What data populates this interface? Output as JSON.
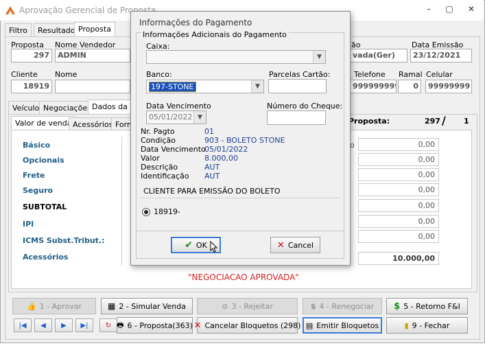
{
  "window": {
    "title": "Aprovação Gerencial de Proposta",
    "controls": [
      "–",
      "▢",
      "✕"
    ]
  },
  "main_tabs": [
    "Filtro",
    "Resultado",
    "Proposta"
  ],
  "header": {
    "proposta_label": "Proposta",
    "proposta_value": "297",
    "vendedor_label": "Nome Vendedor",
    "vendedor_value": "ADMIN",
    "situacao_label": "ão",
    "situacao_value": "vada(Ger)",
    "data_emissao_label": "Data Emissão",
    "data_emissao_value": "23/12/2021",
    "cliente_label": "Cliente",
    "cliente_value": "18919",
    "nome_label": "Nome",
    "telefone_label": "Telefone",
    "telefone_value": "999999999",
    "ramal_label": "Ramal",
    "ramal_value": "0",
    "celular_label": "Celular",
    "celular_value": "99999999"
  },
  "sub_tabs": [
    "Veículo",
    "Negociações",
    "Dados da Ne"
  ],
  "inner_tabs": [
    "Valor de venda",
    "Acessórios",
    "Form"
  ],
  "proposta_summary": {
    "label": "Proposta:",
    "number": "297",
    "sep": "/",
    "version": "1"
  },
  "value_rows": [
    {
      "label": "Básico",
      "value": "0,00"
    },
    {
      "label": "Opcionais",
      "value": "0,00"
    },
    {
      "label": "Frete",
      "value": "0,00"
    },
    {
      "label": "Seguro",
      "value": "0,00"
    },
    {
      "label": "SUBTOTAL",
      "value": "0,00"
    },
    {
      "label": "IPI",
      "value": "0,00"
    },
    {
      "label": "ICMS Subst.Tribut.:",
      "value": "0,00"
    },
    {
      "label": "Acessórios",
      "value": "10.000,00"
    }
  ],
  "status_message": "\"NEGOCIACAO APROVADA\"",
  "buttons_row1": [
    {
      "label": "1 - Aprovar",
      "icon": "thumbs-up-icon",
      "disabled": true
    },
    {
      "label": "2 - Simular Venda",
      "icon": "calculator-icon",
      "disabled": false
    },
    {
      "label": "3 - Rejeitar",
      "icon": "block-icon",
      "disabled": true
    },
    {
      "label": "4 - Renegociar",
      "icon": "dollar-icon",
      "disabled": true
    },
    {
      "label": "5 - Retorno F&I",
      "icon": "dollar-icon",
      "disabled": false
    }
  ],
  "buttons_row2": [
    {
      "label": "6 - Proposta(363)",
      "icon": "printer-icon"
    },
    {
      "label": "Cancelar Bloquetos (298)",
      "icon": "x-icon"
    },
    {
      "label": "Emitir Bloquetos",
      "icon": "document-icon"
    },
    {
      "label": "9 - Fechar",
      "icon": "door-exit-icon"
    }
  ],
  "nav_buttons": [
    "|◀",
    "◀",
    "▶",
    "▶|"
  ],
  "dialog": {
    "title": "Informações do Pagamento",
    "group_caption": "Informações Adicionais do Pagamento",
    "caixa_label": "Caixa:",
    "caixa_value": "",
    "banco_label": "Banco:",
    "banco_value": "197-STONE",
    "parcelas_label": "Parcelas Cartão:",
    "parcelas_value": "",
    "data_venc_label": "Data Vencimento",
    "data_venc_value": "05/01/2022",
    "cheque_label": "Número do Cheque:",
    "cheque_value": "",
    "info": [
      {
        "label": "Nr. Pagto",
        "value": "01"
      },
      {
        "label": "Condição",
        "value": "903 - BOLETO STONE"
      },
      {
        "label": "Data Vencimento",
        "value": "05/01/2022"
      },
      {
        "label": "Valor",
        "value": "8.000,00"
      },
      {
        "label": "Descrição",
        "value": "AUT"
      },
      {
        "label": "Identificação",
        "value": "AUT"
      }
    ],
    "cliente_caption": "CLIENTE PARA EMISSÃO DO BOLETO",
    "radio_label": "18919-",
    "ok_label": "OK",
    "cancel_label": "Cancel"
  },
  "colors": {
    "accent_blue": "#1f5f86",
    "status_red": "#d02020",
    "link_blue": "#1f3f8f",
    "focus": "#3b7bd6"
  }
}
